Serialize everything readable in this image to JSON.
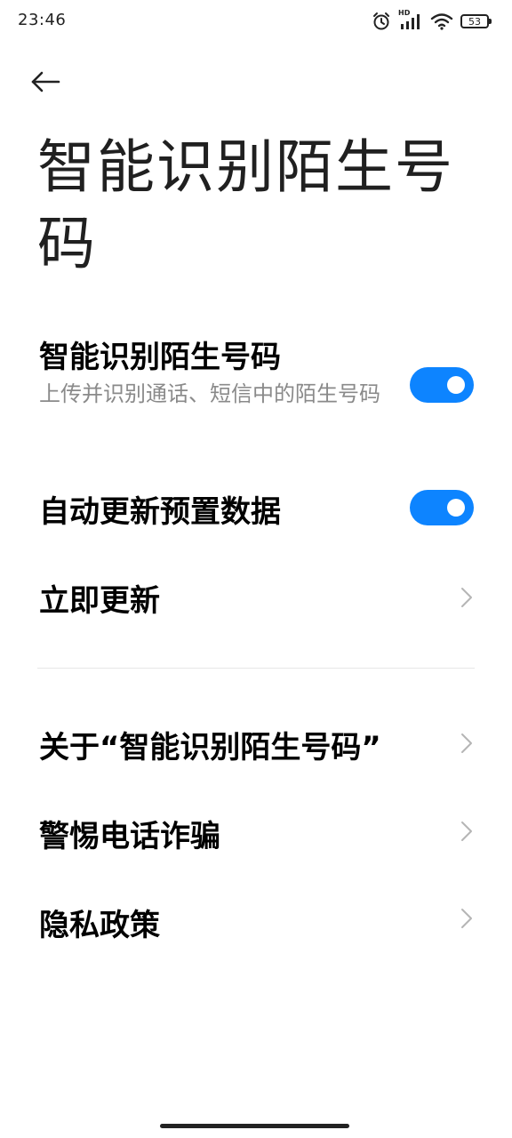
{
  "status_bar": {
    "time": "23:46",
    "icons": [
      "alarm-icon",
      "hd-signal-icon",
      "wifi-icon",
      "battery-icon"
    ],
    "hd_label": "HD",
    "battery_level": "53"
  },
  "header": {
    "back_icon": "arrow-left-icon",
    "title": "智能识别陌生号码"
  },
  "settings": {
    "smart_identify": {
      "title": "智能识别陌生号码",
      "subtitle": "上传并识别通话、短信中的陌生号码",
      "enabled": true
    },
    "auto_update": {
      "title": "自动更新预置数据",
      "enabled": true
    },
    "update_now": {
      "title": "立即更新"
    }
  },
  "links": {
    "about": "关于“智能识别陌生号码”",
    "fraud_warning": "警惕电话诈骗",
    "privacy_policy": "隐私政策"
  },
  "colors": {
    "accent": "#0d84ff",
    "text_primary": "#000000",
    "text_secondary": "#8a8a8a",
    "divider": "#e6e6e6"
  }
}
